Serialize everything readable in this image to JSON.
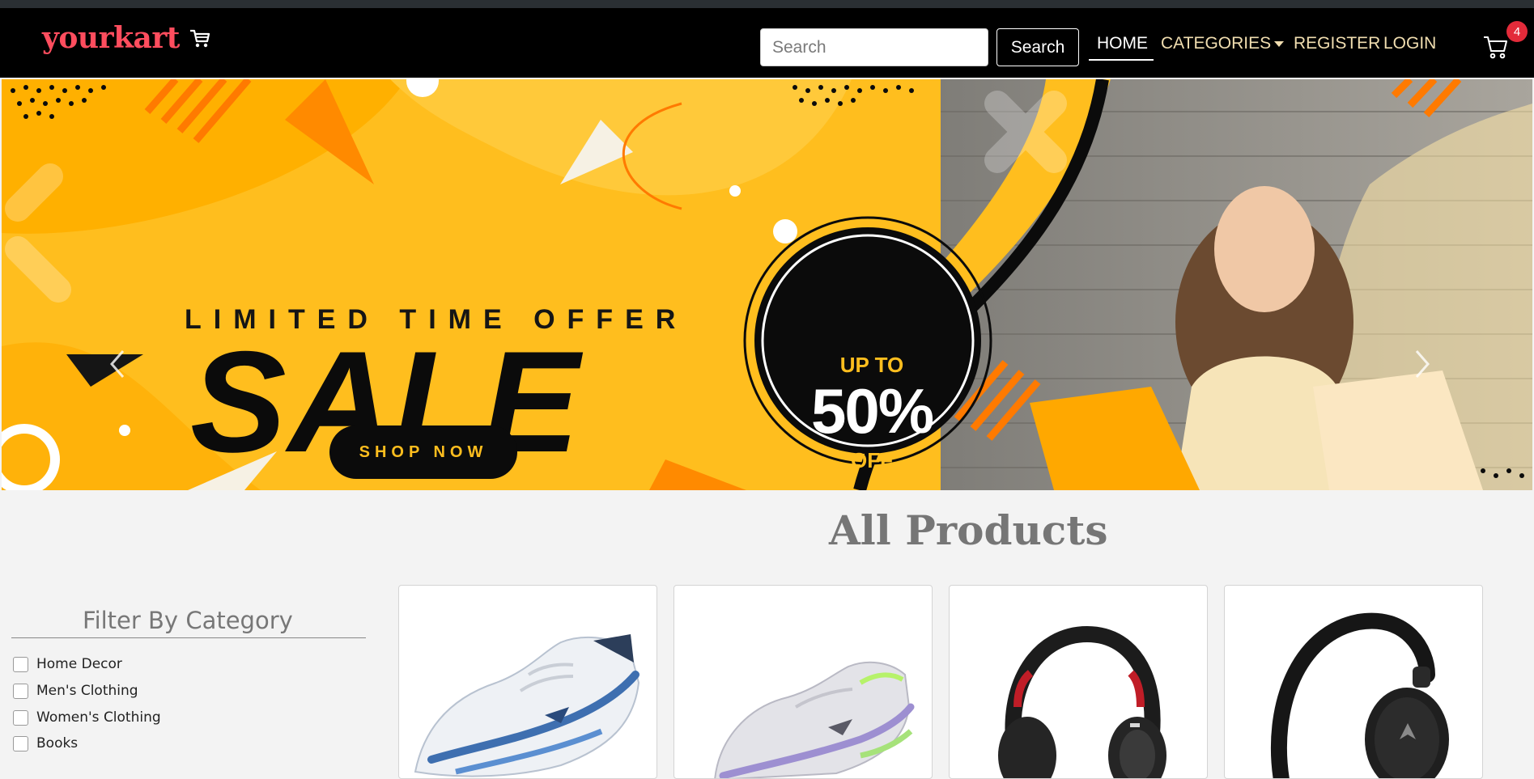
{
  "brand": {
    "name": "yourkart",
    "cart_icon": "cart-icon"
  },
  "search": {
    "placeholder": "Search",
    "value": "",
    "button_label": "Search"
  },
  "nav": {
    "items": [
      {
        "label": "HOME",
        "active": true
      },
      {
        "label": "CATEGORIES",
        "dropdown": true
      },
      {
        "label": "REGISTER"
      },
      {
        "label": "LOGIN"
      }
    ],
    "cart_count": "4"
  },
  "banner": {
    "headline": "LIMITED TIME OFFER",
    "title": "SALE",
    "button_label": "SHOP NOW",
    "offer": {
      "top": "UP TO",
      "value": "50%",
      "bottom": "OFF"
    },
    "colors": {
      "accent": "#ffbe1e",
      "dark": "#0b0b0b",
      "orange": "#ff7a00"
    }
  },
  "products_section": {
    "title": "All Products"
  },
  "filter": {
    "title": "Filter By Category",
    "categories": [
      "Home Decor",
      "Men's Clothing",
      "Women's Clothing",
      "Books"
    ]
  },
  "products": [
    {
      "image": "white-blue-sneaker"
    },
    {
      "image": "grey-lilac-sneaker"
    },
    {
      "image": "black-red-headphones"
    },
    {
      "image": "black-headphones"
    }
  ]
}
